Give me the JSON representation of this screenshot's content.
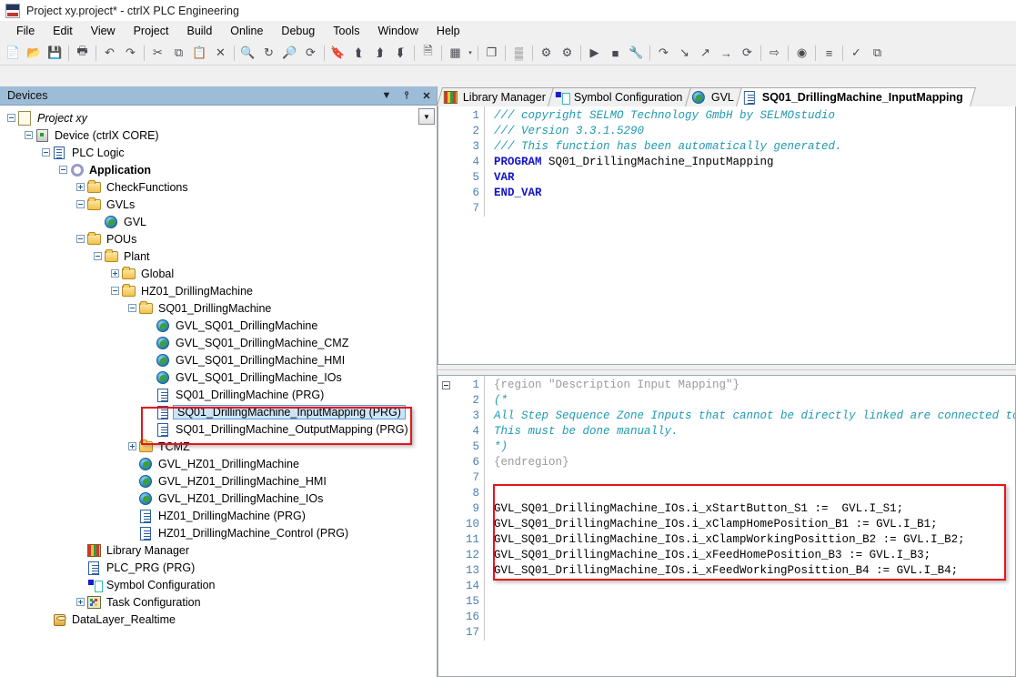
{
  "window": {
    "title": "Project xy.project* - ctrlX PLC Engineering",
    "app_icon": "plc-app-icon"
  },
  "menubar": {
    "items": [
      "File",
      "Edit",
      "View",
      "Project",
      "Build",
      "Online",
      "Debug",
      "Tools",
      "Window",
      "Help"
    ]
  },
  "toolbar": {
    "groups": [
      {
        "buttons": [
          {
            "name": "new-project-icon",
            "glyph": "📄"
          },
          {
            "name": "open-project-icon",
            "glyph": "📂"
          },
          {
            "name": "save-project-icon",
            "glyph": "💾"
          }
        ]
      },
      {
        "buttons": [
          {
            "name": "print-icon",
            "glyph": "🖶"
          }
        ]
      },
      {
        "buttons": [
          {
            "name": "undo-icon",
            "glyph": "↶"
          },
          {
            "name": "redo-icon",
            "glyph": "↷"
          }
        ]
      },
      {
        "buttons": [
          {
            "name": "cut-icon",
            "glyph": "✂"
          },
          {
            "name": "copy-icon",
            "glyph": "⧉"
          },
          {
            "name": "paste-icon",
            "glyph": "📋"
          },
          {
            "name": "delete-icon",
            "glyph": "✕"
          }
        ]
      },
      {
        "buttons": [
          {
            "name": "find-icon",
            "glyph": "🔍"
          },
          {
            "name": "replace-icon",
            "glyph": "↻"
          },
          {
            "name": "find-in-project-icon",
            "glyph": "🔎"
          },
          {
            "name": "replace-in-project-icon",
            "glyph": "⟳"
          }
        ]
      },
      {
        "buttons": [
          {
            "name": "toggle-bookmark-icon",
            "glyph": "🔖"
          },
          {
            "name": "previous-bookmark-icon",
            "glyph": "⮬"
          },
          {
            "name": "next-bookmark-icon",
            "glyph": "⮭"
          },
          {
            "name": "clear-bookmarks-icon",
            "glyph": "⮮"
          }
        ]
      },
      {
        "buttons": [
          {
            "name": "project-information-icon",
            "glyph": "🗎"
          }
        ]
      },
      {
        "buttons": [
          {
            "name": "build-icon",
            "glyph": "▦"
          },
          {
            "name": "build-dropdown-icon",
            "glyph": "▾"
          }
        ]
      },
      {
        "buttons": [
          {
            "name": "generate-code-icon",
            "glyph": "❐"
          }
        ]
      },
      {
        "buttons": [
          {
            "name": "task-deployment-icon",
            "glyph": "▒"
          }
        ]
      },
      {
        "buttons": [
          {
            "name": "login-icon",
            "glyph": "⚙"
          },
          {
            "name": "logout-icon",
            "glyph": "⚙"
          }
        ]
      },
      {
        "buttons": [
          {
            "name": "start-icon",
            "glyph": "▶"
          },
          {
            "name": "stop-icon",
            "glyph": "■"
          },
          {
            "name": "debug-tools-icon",
            "glyph": "🔧"
          }
        ]
      },
      {
        "buttons": [
          {
            "name": "step-over-icon",
            "glyph": "↷"
          },
          {
            "name": "step-into-icon",
            "glyph": "↘"
          },
          {
            "name": "step-out-icon",
            "glyph": "↗"
          },
          {
            "name": "run-to-cursor-icon",
            "glyph": "→"
          },
          {
            "name": "set-next-statement-icon",
            "glyph": "⟳"
          }
        ]
      },
      {
        "buttons": [
          {
            "name": "show-next-statement-icon",
            "glyph": "⇨"
          }
        ]
      },
      {
        "buttons": [
          {
            "name": "toggle-breakpoint-icon",
            "glyph": "◉"
          }
        ]
      },
      {
        "buttons": [
          {
            "name": "write-values-icon",
            "glyph": "≡"
          }
        ]
      },
      {
        "buttons": [
          {
            "name": "force-values-icon",
            "glyph": "✓"
          },
          {
            "name": "single-cycle-icon",
            "glyph": "⧉"
          }
        ]
      }
    ]
  },
  "devices_panel": {
    "title": "Devices",
    "header_buttons": [
      {
        "name": "dropdown-icon",
        "glyph": "▼"
      },
      {
        "name": "pin-icon",
        "glyph": "⫯"
      },
      {
        "name": "close-icon",
        "glyph": "✕"
      }
    ],
    "scroll_button": {
      "name": "scroll-down-icon",
      "glyph": "▼"
    },
    "tree": [
      {
        "label": "Project xy",
        "depth": 0,
        "icon": "project",
        "expander": "minus",
        "style": "italic"
      },
      {
        "label": "Device (ctrlX CORE)",
        "depth": 1,
        "icon": "device",
        "expander": "minus",
        "style": ""
      },
      {
        "label": "PLC Logic",
        "depth": 2,
        "icon": "plclogic",
        "expander": "minus",
        "style": ""
      },
      {
        "label": "Application",
        "depth": 3,
        "icon": "app",
        "expander": "minus",
        "style": "bold"
      },
      {
        "label": "CheckFunctions",
        "depth": 4,
        "icon": "folder",
        "expander": "plus",
        "style": ""
      },
      {
        "label": "GVLs",
        "depth": 4,
        "icon": "folder",
        "expander": "minus",
        "style": ""
      },
      {
        "label": "GVL",
        "depth": 5,
        "icon": "globe",
        "expander": "none",
        "style": ""
      },
      {
        "label": "POUs",
        "depth": 4,
        "icon": "folder",
        "expander": "minus",
        "style": ""
      },
      {
        "label": "Plant",
        "depth": 5,
        "icon": "folder",
        "expander": "minus",
        "style": ""
      },
      {
        "label": "Global",
        "depth": 6,
        "icon": "folder",
        "expander": "plus",
        "style": ""
      },
      {
        "label": "HZ01_DrillingMachine",
        "depth": 6,
        "icon": "folder",
        "expander": "minus",
        "style": ""
      },
      {
        "label": "SQ01_DrillingMachine",
        "depth": 7,
        "icon": "folder",
        "expander": "minus",
        "style": ""
      },
      {
        "label": "GVL_SQ01_DrillingMachine",
        "depth": 8,
        "icon": "globe",
        "expander": "none",
        "style": ""
      },
      {
        "label": "GVL_SQ01_DrillingMachine_CMZ",
        "depth": 8,
        "icon": "globe",
        "expander": "none",
        "style": ""
      },
      {
        "label": "GVL_SQ01_DrillingMachine_HMI",
        "depth": 8,
        "icon": "globe",
        "expander": "none",
        "style": ""
      },
      {
        "label": "GVL_SQ01_DrillingMachine_IOs",
        "depth": 8,
        "icon": "globe",
        "expander": "none",
        "style": ""
      },
      {
        "label": "SQ01_DrillingMachine (PRG)",
        "depth": 8,
        "icon": "prg",
        "expander": "none",
        "style": ""
      },
      {
        "label": "SQ01_DrillingMachine_InputMapping (PRG)",
        "depth": 8,
        "icon": "prg",
        "expander": "none",
        "style": "",
        "selected": true
      },
      {
        "label": "SQ01_DrillingMachine_OutputMapping (PRG)",
        "depth": 8,
        "icon": "prg",
        "expander": "none",
        "style": ""
      },
      {
        "label": "TCMZ",
        "depth": 7,
        "icon": "folder",
        "expander": "plus",
        "style": ""
      },
      {
        "label": "GVL_HZ01_DrillingMachine",
        "depth": 7,
        "icon": "globe",
        "expander": "none",
        "style": ""
      },
      {
        "label": "GVL_HZ01_DrillingMachine_HMI",
        "depth": 7,
        "icon": "globe",
        "expander": "none",
        "style": ""
      },
      {
        "label": "GVL_HZ01_DrillingMachine_IOs",
        "depth": 7,
        "icon": "globe",
        "expander": "none",
        "style": ""
      },
      {
        "label": "HZ01_DrillingMachine (PRG)",
        "depth": 7,
        "icon": "prg",
        "expander": "none",
        "style": ""
      },
      {
        "label": "HZ01_DrillingMachine_Control (PRG)",
        "depth": 7,
        "icon": "prg",
        "expander": "none",
        "style": ""
      },
      {
        "label": "Library Manager",
        "depth": 4,
        "icon": "libmgr",
        "expander": "none",
        "style": ""
      },
      {
        "label": "PLC_PRG (PRG)",
        "depth": 4,
        "icon": "prg",
        "expander": "none",
        "style": ""
      },
      {
        "label": "Symbol Configuration",
        "depth": 4,
        "icon": "symbolcfg",
        "expander": "none",
        "style": ""
      },
      {
        "label": "Task Configuration",
        "depth": 4,
        "icon": "taskcfg",
        "expander": "plus",
        "style": ""
      },
      {
        "label": "DataLayer_Realtime",
        "depth": 2,
        "icon": "datalayer",
        "expander": "none",
        "style": ""
      }
    ]
  },
  "editor": {
    "tabs": [
      {
        "label": "Library Manager",
        "icon": "libmgr",
        "active": false
      },
      {
        "label": "Symbol Configuration",
        "icon": "symbolcfg",
        "active": false
      },
      {
        "label": "GVL",
        "icon": "globe",
        "active": false
      },
      {
        "label": "SQ01_DrillingMachine_InputMapping",
        "icon": "prg",
        "active": true
      }
    ],
    "declaration_pane": {
      "line_numbers": [
        "1",
        "2",
        "3",
        "4",
        "5",
        "6",
        "7"
      ],
      "lines": [
        {
          "text": "/// copyright SELMO Technology GmbH by SELMOstudio",
          "class": "c-comment"
        },
        {
          "text": "/// Version 3.3.1.5290",
          "class": "c-comment"
        },
        {
          "text": "/// This function has been automatically generated.",
          "class": "c-comment"
        },
        {
          "text": "PROGRAM SQ01_DrillingMachine_InputMapping",
          "class": "c-keyword",
          "split": {
            "kw": "PROGRAM",
            "rest": " SQ01_DrillingMachine_InputMapping"
          }
        },
        {
          "text": "VAR",
          "class": "c-keyword"
        },
        {
          "text": "END_VAR",
          "class": "c-keyword"
        },
        {
          "text": "",
          "class": "c-plain"
        }
      ]
    },
    "implementation_pane": {
      "line_numbers": [
        "1",
        "2",
        "3",
        "4",
        "5",
        "6",
        "7",
        "8",
        "9",
        "10",
        "11",
        "12",
        "13",
        "14",
        "15",
        "16",
        "17"
      ],
      "lines": [
        {
          "text": "{region \"Description Input Mapping\"}",
          "class": "c-region"
        },
        {
          "text": "(*",
          "class": "c-comment"
        },
        {
          "text": "All Step Sequence Zone Inputs that cannot be directly linked are connected to th",
          "class": "c-comment"
        },
        {
          "text": "This must be done manually.",
          "class": "c-comment"
        },
        {
          "text": "*)",
          "class": "c-comment"
        },
        {
          "text": "{endregion}",
          "class": "c-region"
        },
        {
          "text": "",
          "class": "c-plain"
        },
        {
          "text": "",
          "class": "c-plain"
        },
        {
          "text": "GVL_SQ01_DrillingMachine_IOs.i_xStartButton_S1 :=  GVL.I_S1;",
          "class": "c-plain"
        },
        {
          "text": "GVL_SQ01_DrillingMachine_IOs.i_xClampHomePosition_B1 := GVL.I_B1;",
          "class": "c-plain"
        },
        {
          "text": "GVL_SQ01_DrillingMachine_IOs.i_xClampWorkingPosittion_B2 := GVL.I_B2;",
          "class": "c-plain"
        },
        {
          "text": "GVL_SQ01_DrillingMachine_IOs.i_xFeedHomePosition_B3 := GVL.I_B3;",
          "class": "c-plain"
        },
        {
          "text": "GVL_SQ01_DrillingMachine_IOs.i_xFeedWorkingPosittion_B4 := GVL.I_B4;",
          "class": "c-plain"
        },
        {
          "text": "",
          "class": "c-plain"
        },
        {
          "text": "",
          "class": "c-plain"
        },
        {
          "text": "",
          "class": "c-plain"
        },
        {
          "text": "",
          "class": "c-plain"
        }
      ]
    }
  },
  "annotations": {
    "highlight_color": "#e8141b",
    "boxes": [
      {
        "name": "tree-selection-highlight-box"
      },
      {
        "name": "code-mapping-highlight-box"
      }
    ]
  }
}
